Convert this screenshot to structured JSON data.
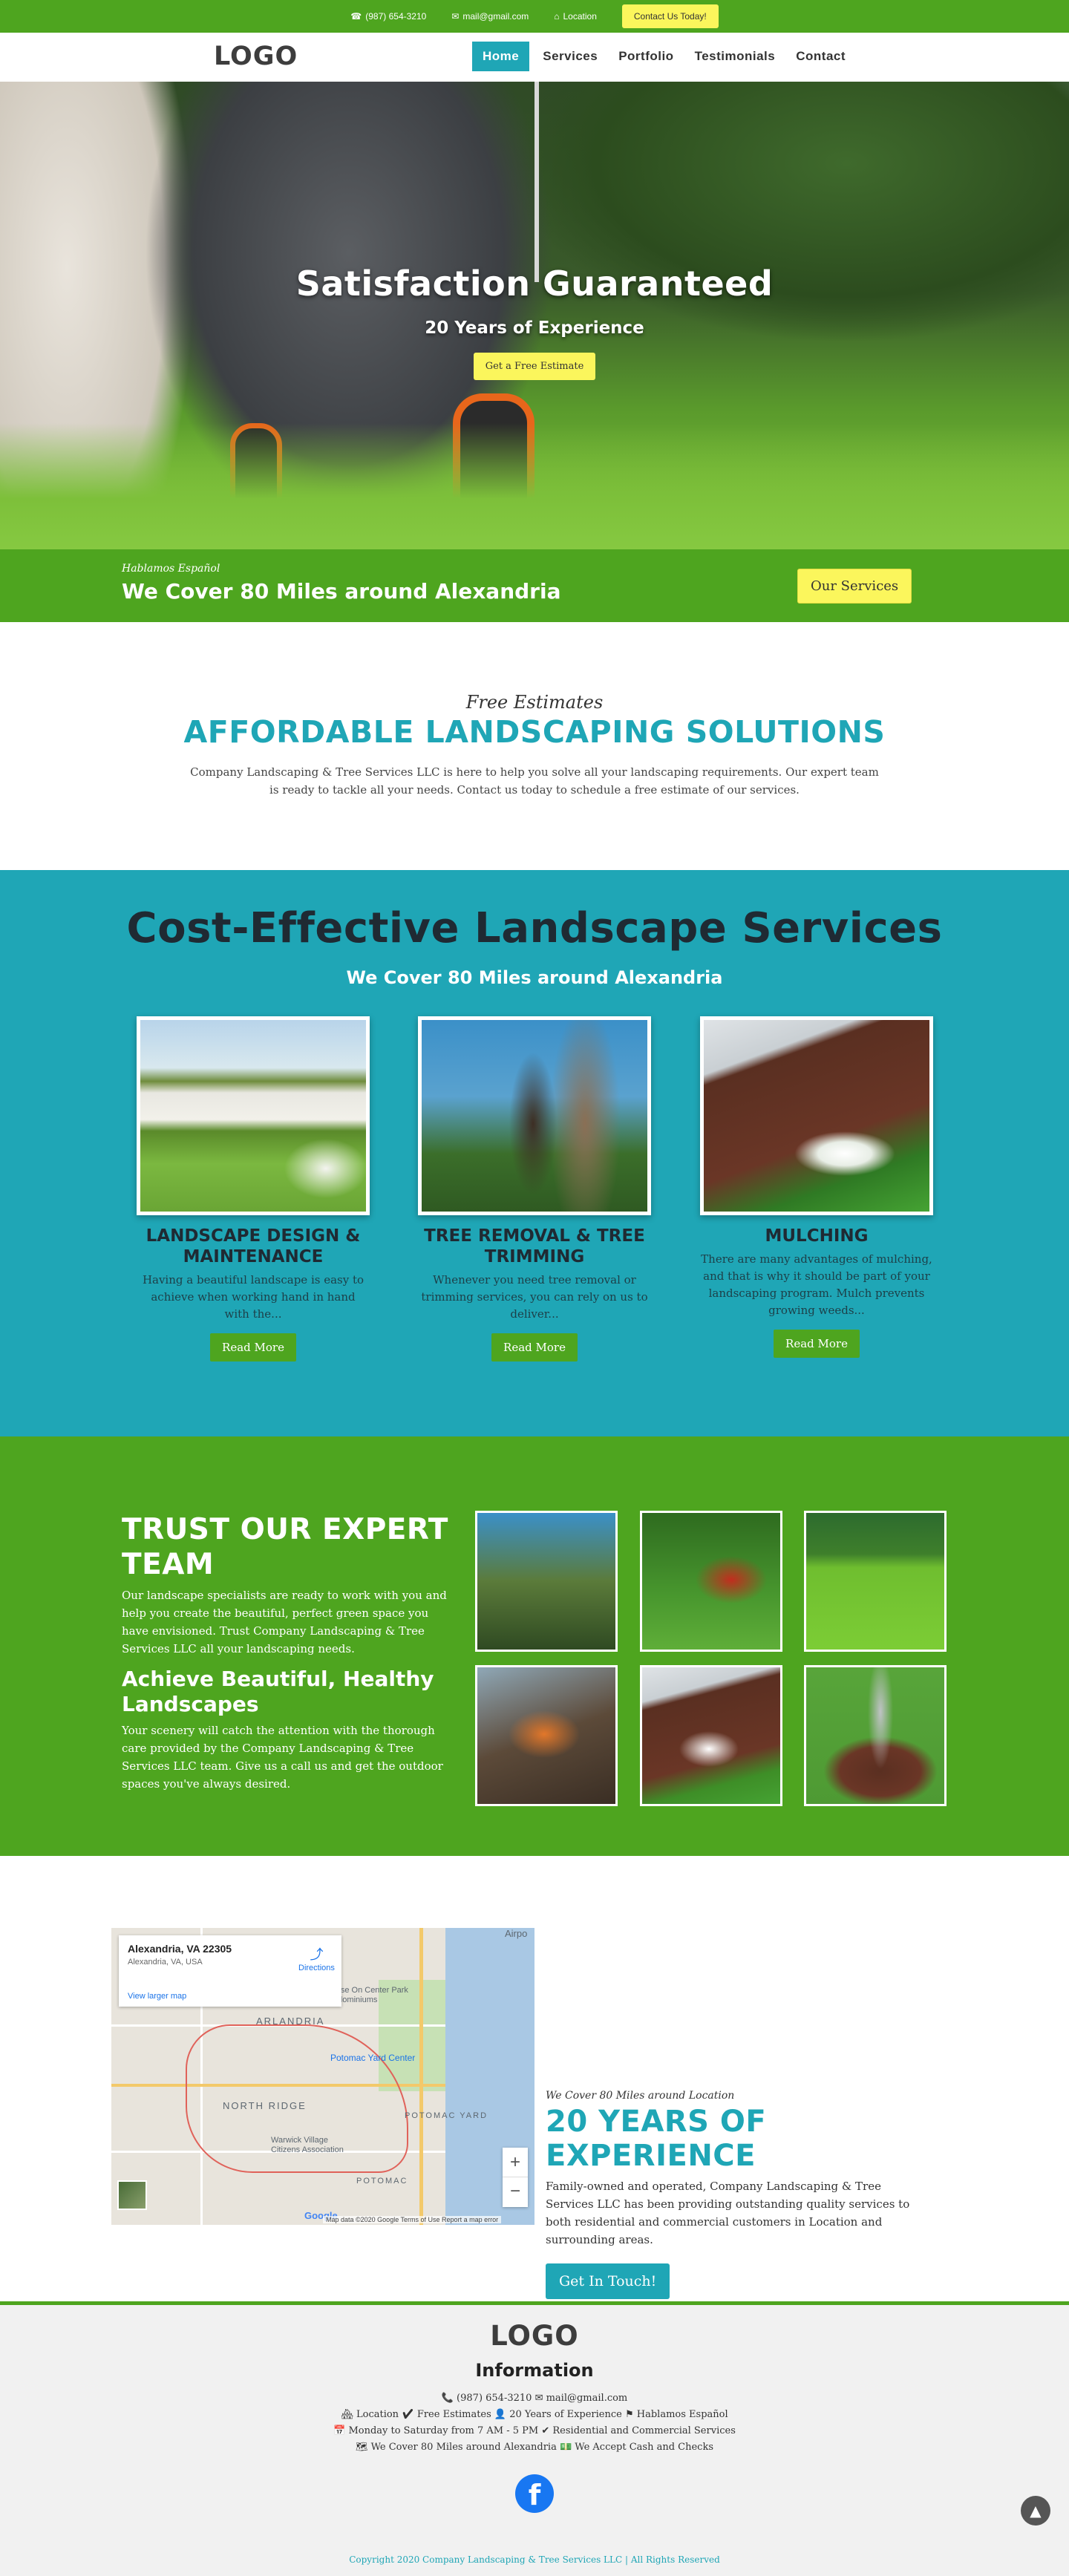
{
  "topbar": {
    "phone": "(987) 654-3210",
    "email": "mail@gmail.com",
    "location": "Location",
    "cta": "Contact Us Today!"
  },
  "nav": {
    "logo": "LOGO",
    "items": [
      "Home",
      "Services",
      "Portfolio",
      "Testimonials",
      "Contact"
    ],
    "active": "Home"
  },
  "hero": {
    "title": "Satisfaction Guaranteed",
    "subtitle": "20 Years of Experience",
    "button": "Get a Free Estimate"
  },
  "band": {
    "sub": "Hablamos Español",
    "main": "We Cover 80 Miles around Alexandria",
    "button": "Our Services"
  },
  "afford": {
    "kicker": "Free Estimates",
    "title": "AFFORDABLE LANDSCAPING SOLUTIONS",
    "text": "Company Landscaping & Tree Services LLC is here to help you solve all your landscaping requirements. Our expert team is ready to tackle all your needs. Contact us today to schedule a free estimate of our services."
  },
  "services": {
    "title": "Cost-Effective Landscape Services",
    "subtitle": "We Cover 80 Miles around Alexandria",
    "cards": [
      {
        "title": "LANDSCAPE DESIGN & MAINTENANCE",
        "text": "Having a beautiful landscape is easy to achieve when working hand in hand with the...",
        "button": "Read More"
      },
      {
        "title": "TREE REMOVAL & TREE TRIMMING",
        "text": "Whenever you need tree removal or trimming services, you can rely on us to deliver...",
        "button": "Read More"
      },
      {
        "title": "MULCHING",
        "text": "There are many advantages of mulching, and that is why it should be part of your landscaping program. Mulch prevents growing weeds...",
        "button": "Read More"
      }
    ]
  },
  "trust": {
    "title": "TRUST OUR EXPERT TEAM",
    "text1": "Our landscape specialists are ready to work with you and help you create the beautiful, perfect green space you have envisioned. Trust Company Landscaping & Tree Services LLC all your landscaping needs.",
    "subtitle": "Achieve Beautiful, Healthy Landscapes",
    "text2": "Your scenery will catch the attention with the thorough care provided by the Company Landscaping & Tree Services LLC team. Give us a call us and get the outdoor spaces you've always desired."
  },
  "map": {
    "place": "Alexandria, VA 22305",
    "address": "Alexandria, VA, USA",
    "directions": "Directions",
    "larger": "View larger map",
    "labels": [
      "ARLANDRIA",
      "NORTH RIDGE",
      "POTOMAC YARD",
      "POTOMAC",
      "Potomac Yard Center",
      "Warwick Village Citizens Association",
      "Eclipse On Center Park Condominiums",
      "Airpo"
    ],
    "footer": "Map data ©2020 Google   Terms of Use   Report a map error",
    "google": "Google",
    "zoom_in": "+",
    "zoom_out": "−"
  },
  "experience": {
    "kicker": "We Cover 80 Miles around Location",
    "title": "20 YEARS OF EXPERIENCE",
    "text": "Family-owned and operated, Company Landscaping & Tree Services LLC has been providing outstanding quality services to both residential and commercial customers in Location and surrounding areas.",
    "button": "Get In Touch!"
  },
  "footer": {
    "logo": "LOGO",
    "heading": "Information",
    "line1": "📞 (987) 654-3210 ✉ mail@gmail.com",
    "line2": "🏘 Location ✔ Free Estimates 👤 20 Years of Experience ⚑ Hablamos Español",
    "line3": "📅 Monday to Saturday from 7 AM - 5 PM ✔ Residential and Commercial Services",
    "line4": "🗺 We Cover 80 Miles around Alexandria 💵 We Accept Cash and Checks",
    "facebook": "f",
    "copyright": "Copyright 2020 Company Landscaping & Tree Services LLC | All Rights Reserved"
  },
  "icons": {
    "phone": "phone-icon",
    "email": "envelope-icon",
    "location": "home-icon",
    "totop": "chevron-up-icon"
  },
  "colors": {
    "green": "#4ea51f",
    "teal": "#1fa6b6",
    "yellow": "#fbf65c",
    "dark": "#1f2a33"
  }
}
